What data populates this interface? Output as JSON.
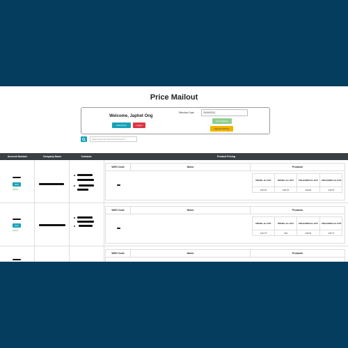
{
  "page": {
    "title": "Price Mailout"
  },
  "header": {
    "welcome": "Welcome, Japhet Ong",
    "add_admin_label": "Add Admin",
    "logout_label": "Logout",
    "effective_date_label": "Effective Date",
    "effective_date_value": "20/09/2021",
    "send_mailout_label": "Send Mailout",
    "approve_pricing_label": "Approve Pricing"
  },
  "search": {
    "placeholder": "Search Account Number/Account N"
  },
  "table": {
    "headers": [
      "Account Number",
      "Company Name",
      "Contacts",
      "Product Pricing"
    ],
    "inner_headers": {
      "wholesale": "WHG Code",
      "notes": "Notes",
      "products": "Products"
    },
    "product_headers": [
      "DIESEL Ex GST",
      "DIESEL Inc GST",
      "UNLEADED Ex GST",
      "UNLEADED Inc GST"
    ],
    "rows": [
      {
        "edit_label": "Edit",
        "status": "Active",
        "prices": [
          "135.23",
          "148.75",
          "129.61",
          "142.57"
        ]
      },
      {
        "edit_label": "Edit",
        "status": "Active",
        "prices": [
          "132.73",
          "146",
          "130.61",
          "143.77"
        ]
      },
      {
        "edit_label": "",
        "status": "",
        "prices": []
      }
    ]
  },
  "icons": {
    "search": "search-icon"
  },
  "colors": {
    "background": "#053d5e",
    "info": "#17a2b8",
    "danger": "#dc3545",
    "success": "#8fce8f",
    "warning": "#f0b400",
    "table_header": "#3a3f44"
  }
}
